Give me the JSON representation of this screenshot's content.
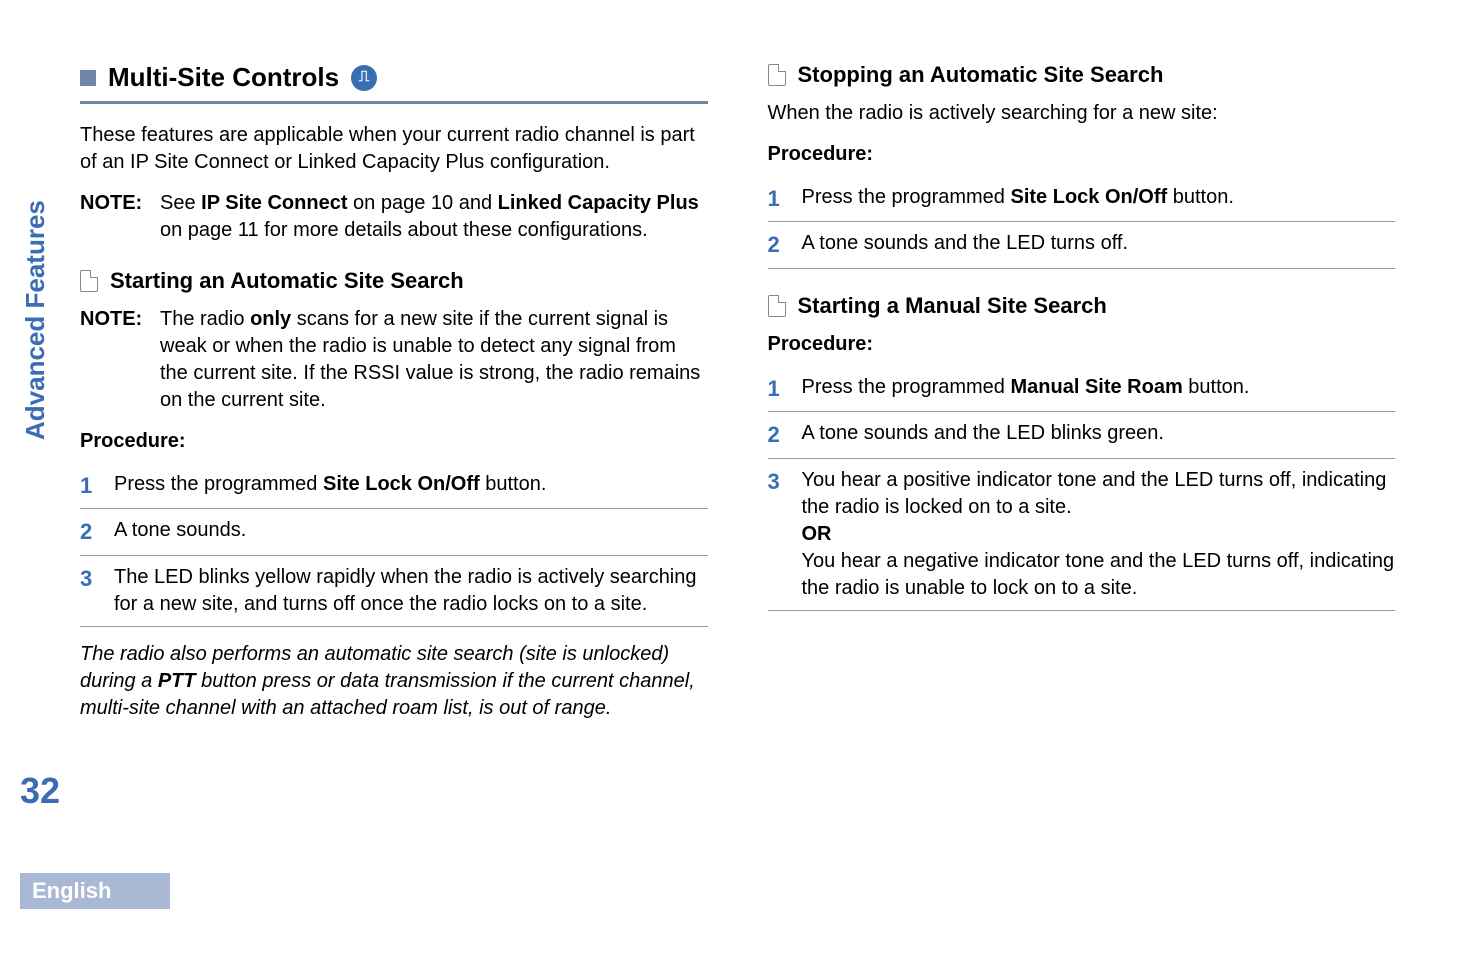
{
  "sidebar": {
    "tab": "Advanced Features",
    "page_number": "32",
    "language": "English"
  },
  "left": {
    "main_heading": "Multi-Site Controls",
    "intro": "These features are applicable when your current radio channel is part of an IP Site Connect or Linked Capacity Plus configuration.",
    "note1_label": "NOTE:",
    "note1_a": "See ",
    "note1_b": "IP Site Connect",
    "note1_c": " on page 10 and ",
    "note1_d": "Linked Capacity Plus",
    "note1_e": " on page 11 for more details about these configurations.",
    "sub1": "Starting an Automatic Site Search",
    "note2_label": "NOTE:",
    "note2_a": "The radio ",
    "note2_b": "only",
    "note2_c": " scans for a new site if the current signal is weak or when the radio is unable to detect any signal from the current site. If the RSSI value is strong, the radio remains on the current site.",
    "procedure": "Procedure:",
    "steps": [
      {
        "n": "1",
        "a": "Press the programmed ",
        "b": "Site Lock On/Off",
        "c": " button."
      },
      {
        "n": "2",
        "a": "A tone sounds.",
        "b": "",
        "c": ""
      },
      {
        "n": "3",
        "a": "The LED blinks yellow rapidly when the radio is actively searching for a new site, and turns off once the radio locks on to a site.",
        "b": "",
        "c": ""
      }
    ],
    "italic_a": "The radio also performs an automatic site search (site is unlocked) during a ",
    "italic_b": "PTT",
    "italic_c": " button press or data transmission if the current channel, multi-site channel with an attached roam list, is out of range."
  },
  "right": {
    "sub1": "Stopping an Automatic Site Search",
    "intro1": "When the radio is actively searching for a new site:",
    "procedure": "Procedure:",
    "steps1": [
      {
        "n": "1",
        "a": "Press the programmed ",
        "b": "Site Lock On/Off",
        "c": " button."
      },
      {
        "n": "2",
        "a": "A tone sounds and the LED turns off.",
        "b": "",
        "c": ""
      }
    ],
    "sub2": "Starting a Manual Site Search",
    "steps2": [
      {
        "n": "1",
        "a": "Press the programmed ",
        "b": "Manual Site Roam",
        "c": " button."
      },
      {
        "n": "2",
        "a": "A tone sounds and the LED blinks green.",
        "b": "",
        "c": ""
      }
    ],
    "step3_n": "3",
    "step3_a": "You hear a positive indicator tone and the LED turns off, indicating the radio is locked on to a site.",
    "step3_or": "OR",
    "step3_b": "You hear a negative indicator tone and the LED turns off, indicating the radio is unable to lock on to a site."
  }
}
